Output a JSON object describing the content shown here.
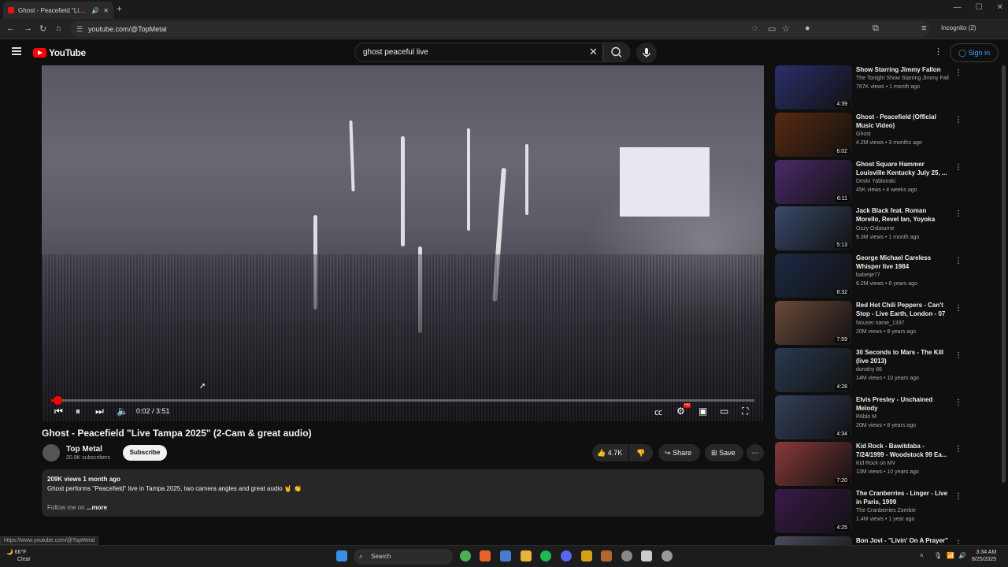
{
  "browser": {
    "tab_title": "Ghost - Peacefield \"Live Ta...",
    "url": "youtube.com/@TopMetal",
    "profile_label": "Incognito (2)",
    "status_url": "https://www.youtube.com/@TopMetal"
  },
  "header": {
    "logo_text": "YouTube",
    "search_value": "ghost peaceful live",
    "signin_label": "Sign in"
  },
  "player": {
    "current_time": "0:02",
    "duration": "3:51",
    "time_display": "0:02 / 3:51",
    "progress_fraction": 0.009,
    "hd_badge": "HD"
  },
  "video": {
    "title": "Ghost - Peacefield \"Live Tampa 2025\" (2-Cam & great audio)",
    "channel": "Top Metal",
    "subscribers": "20.9K subscribers",
    "subscribe_label": "Subscribe",
    "likes": "4.7K",
    "share_label": "Share",
    "save_label": "Save",
    "description_meta": "209K views  1 month ago",
    "description_line": "Ghost performs \"Peacefield\" live in Tampa 2025, two camera angles and great audio 🤘 👏",
    "follow_text": "Follow me on",
    "more_label": "...more"
  },
  "sidebar": {
    "items": [
      {
        "title": "Show Starring Jimmy Fallon",
        "channel": "The Tonight Show Starring Jimmy Fallon",
        "meta": "767K views • 1 month ago",
        "duration": "4:39",
        "color": "#2a2f6b"
      },
      {
        "title": "Ghost - Peacefield (Official Music Video)",
        "channel": "Ghost",
        "meta": "4.2M views • 3 months ago",
        "duration": "6:02",
        "color": "#5a2a10"
      },
      {
        "title": "Ghost Square Hammer Louisville Kentucky July 25, ...",
        "channel": "Dmitri Yablonski",
        "meta": "45K views • 4 weeks ago",
        "duration": "6:11",
        "color": "#4a2a6a"
      },
      {
        "title": "Jack Black feat. Roman Morello, Revel Ian, Yoyoka Soma & Hug...",
        "channel": "Ozzy Osbourne",
        "meta": "9.3M views • 1 month ago",
        "duration": "5:13",
        "color": "#3a4a6a"
      },
      {
        "title": "George Michael Careless Whisper  live 1984",
        "channel": "babetje77",
        "meta": "6.2M views • 8 years ago",
        "duration": "8:32",
        "color": "#1c2a45"
      },
      {
        "title": "Red Hot Chili Peppers - Can't Stop - Live Earth, London - 07 ...",
        "channel": "Nouser name_1337",
        "meta": "20M views • 8 years ago",
        "duration": "7:59",
        "color": "#6a4a3a"
      },
      {
        "title": "30 Seconds to Mars - The Kill (live 2013)",
        "channel": "dorothy 66",
        "meta": "14M views • 10 years ago",
        "duration": "4:28",
        "color": "#2a3a50"
      },
      {
        "title": "Elvis Presley - Unchained Melody",
        "channel": "PAblo M",
        "meta": "20M views • 8 years ago",
        "duration": "4:34",
        "color": "#33405a"
      },
      {
        "title": "Kid Rock - Bawitdaba - 7/24/1999 - Woodstock 99 Ea...",
        "channel": "Kid Rock on MV",
        "meta": "13M views • 10 years ago",
        "duration": "7:20",
        "color": "#8a3a3a"
      },
      {
        "title": "The Cranberries - Linger - Live in Paris, 1999",
        "channel": "The Cranberries Zombie",
        "meta": "1.4M views • 1 year ago",
        "duration": "4:25",
        "color": "#3a1a4a"
      },
      {
        "title": "Bon Jovi - \"Livin' On A Prayer\" | 2018 Induction",
        "channel": "",
        "meta": "",
        "duration": "",
        "color": "#4a4a5a"
      }
    ]
  },
  "taskbar": {
    "weather_temp": "66°F",
    "weather_desc": "Clear",
    "search_label": "Search",
    "time": "3:34 AM",
    "date": "8/25/2025"
  },
  "colors": {
    "brand_red": "#ff0000",
    "link_blue": "#3ea6ff",
    "background": "#0f0f0f"
  }
}
